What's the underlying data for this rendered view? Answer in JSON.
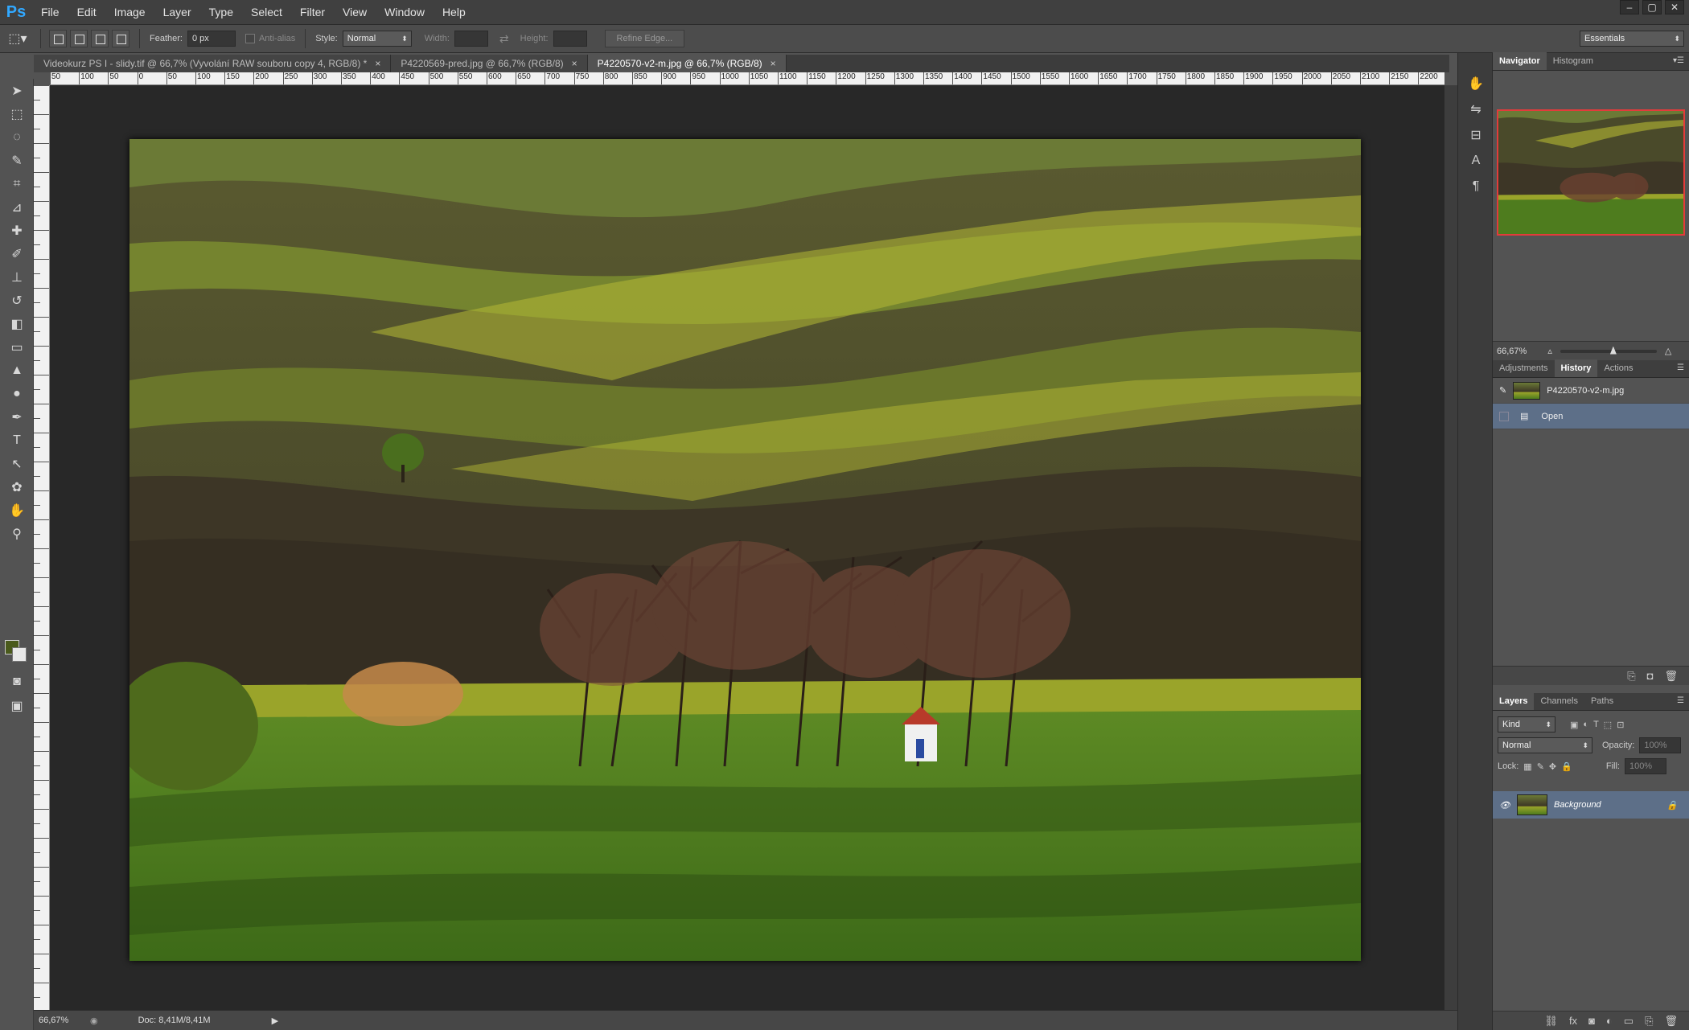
{
  "app": {
    "logo": "Ps"
  },
  "menu": [
    "File",
    "Edit",
    "Image",
    "Layer",
    "Type",
    "Select",
    "Filter",
    "View",
    "Window",
    "Help"
  ],
  "window_controls": [
    "–",
    "▢",
    "✕"
  ],
  "options": {
    "feather_label": "Feather:",
    "feather_value": "0 px",
    "antialias_label": "Anti-alias",
    "style_label": "Style:",
    "style_value": "Normal",
    "width_label": "Width:",
    "height_label": "Height:",
    "refine_edge": "Refine Edge...",
    "workspace": "Essentials"
  },
  "tabs": [
    {
      "label": "Videokurz PS I - slidy.tif @ 66,7% (Vyvolání RAW souboru copy 4, RGB/8) *",
      "active": false
    },
    {
      "label": "P4220569-pred.jpg @ 66,7% (RGB/8)",
      "active": false
    },
    {
      "label": "P4220570-v2-m.jpg @ 66,7% (RGB/8)",
      "active": true
    }
  ],
  "ruler_h": [
    "50",
    "100",
    "50",
    "0",
    "50",
    "100",
    "150",
    "200",
    "250",
    "300",
    "350",
    "400",
    "450",
    "500",
    "550",
    "600",
    "650",
    "700",
    "750",
    "800",
    "850",
    "900",
    "950",
    "1000",
    "1050",
    "1100",
    "1150",
    "1200",
    "1250",
    "1300",
    "1350",
    "1400",
    "1450",
    "1500",
    "1550",
    "1600",
    "1650",
    "1700",
    "1750",
    "1800",
    "1850",
    "1900",
    "1950",
    "2000",
    "2050",
    "2100",
    "2150",
    "2200"
  ],
  "status": {
    "zoom": "66,67%",
    "doc": "Doc: 8,41M/8,41M"
  },
  "navigator": {
    "tabs": [
      "Navigator",
      "Histogram"
    ],
    "zoom": "66,67%"
  },
  "history": {
    "tabs": [
      "Adjustments",
      "History",
      "Actions"
    ],
    "snapshot": "P4220570-v2-m.jpg",
    "states": [
      "Open"
    ]
  },
  "layers": {
    "tabs": [
      "Layers",
      "Channels",
      "Paths"
    ],
    "kind": "Kind",
    "blend": "Normal",
    "opacity_label": "Opacity:",
    "opacity_value": "100%",
    "lock_label": "Lock:",
    "fill_label": "Fill:",
    "fill_value": "100%",
    "items": [
      {
        "name": "Background"
      }
    ]
  },
  "colors": {
    "foreground": "#4a5a1c",
    "background": "#e8e8e8",
    "accent_selection": "#5d6f88"
  }
}
